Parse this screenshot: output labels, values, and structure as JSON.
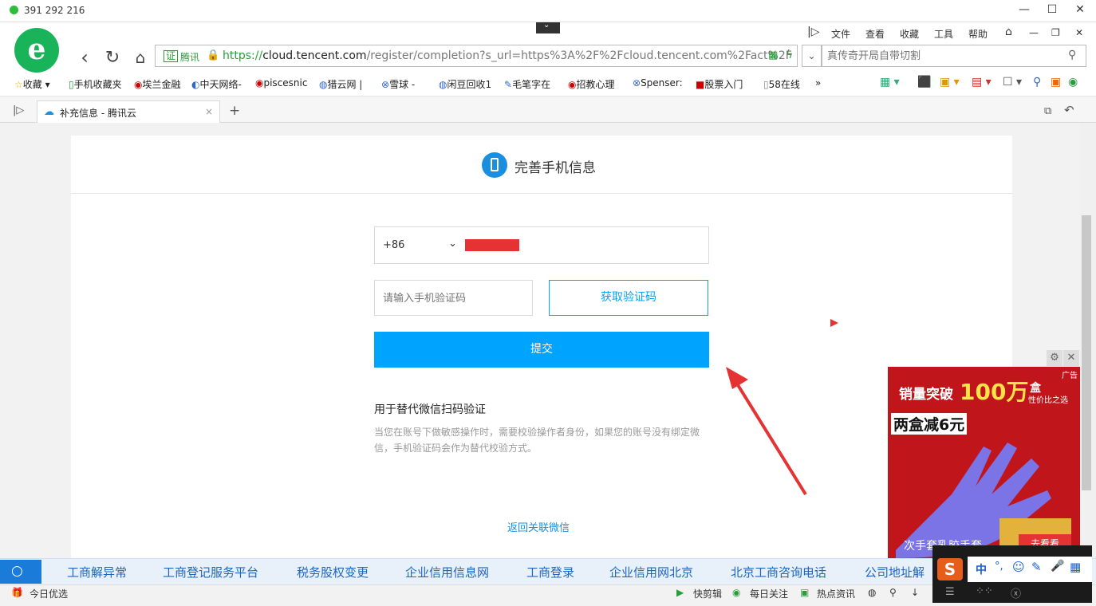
{
  "titlebar": {
    "qq": "391 292 216"
  },
  "menu": [
    "文件",
    "查看",
    "收藏",
    "工具",
    "帮助"
  ],
  "address": {
    "badge": "证",
    "badge_name": "腾讯",
    "url_prefix": "https://",
    "url_host": "cloud.tencent.com",
    "url_path": "/register/completion?s_url=https%3A%2F%2Fcloud.tencent.com%2Fact%2F"
  },
  "search": {
    "placeholder": "真传奇开局自带切割"
  },
  "bookmarks": [
    "收藏",
    "手机收藏夹",
    "埃兰金融",
    "中天网络-",
    "piscesnic",
    "猎云网 |",
    "雪球 -",
    "闲豆回收1",
    "毛笔字在",
    "招教心理",
    "Spenser:",
    "股票入门",
    "58在线"
  ],
  "tab": {
    "title": "补充信息 - 腾讯云"
  },
  "form": {
    "header": "完善手机信息",
    "country_code": "+86",
    "code_placeholder": "请输入手机验证码",
    "get_code": "获取验证码",
    "submit": "提交",
    "info_title": "用于替代微信扫码验证",
    "info_text": "当您在账号下做敏感操作时，需要校验操作者身份，如果您的账号没有绑定微信，手机验证码会作为替代校验方式。",
    "back_link": "返回关联微信"
  },
  "ad": {
    "label": "广告",
    "line1": "销量突破",
    "line1_big": "100万",
    "line1_tail": "盒",
    "line1_sub": "性价比之选",
    "line2": "两盒减6元",
    "cta": "去看看",
    "bottom": "次手套乳胶手套"
  },
  "links": [
    "工商解异常",
    "工商登记服务平台",
    "税务股权变更",
    "企业信用信息网",
    "工商登录",
    "企业信用网北京",
    "北京工商咨询电话",
    "公司地址解"
  ],
  "status": {
    "left": "今日优选",
    "items": [
      "快剪辑",
      "每日关注",
      "热点资讯"
    ]
  },
  "ime": {
    "items": [
      "中",
      "°,",
      "☺",
      "✎",
      "🎤",
      "▦"
    ]
  }
}
